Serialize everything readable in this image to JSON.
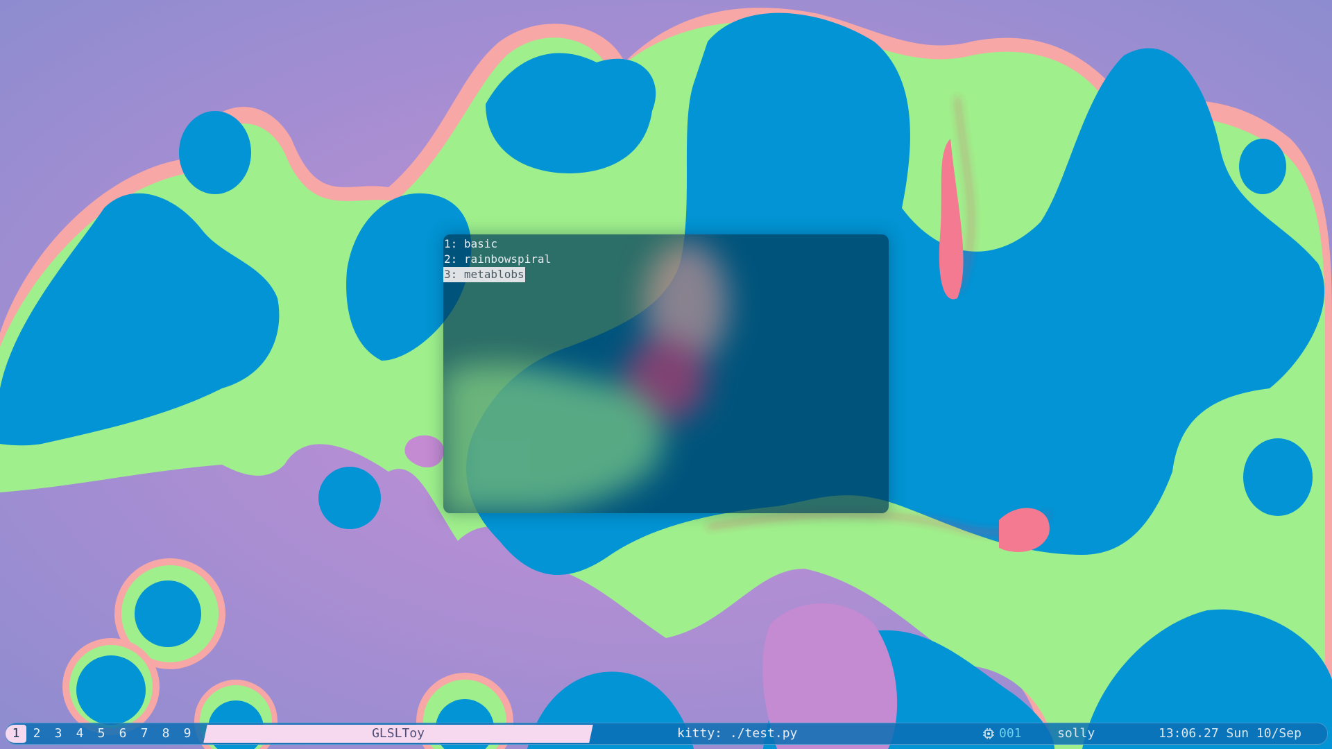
{
  "terminal_menu": {
    "items": [
      {
        "label": "1: basic",
        "selected": false
      },
      {
        "label": "2: rainbowspiral",
        "selected": false
      },
      {
        "label": "3: metablobs",
        "selected": true
      }
    ]
  },
  "statusbar": {
    "workspaces": [
      "1",
      "2",
      "3",
      "4",
      "5",
      "6",
      "7",
      "8",
      "9"
    ],
    "active_workspace": "1",
    "window_title": "GLSLToy",
    "focused_app": "kitty: ./test.py",
    "cpu_icon": "cpu-icon",
    "cpu_value": "001",
    "user": "solly",
    "clock": "13:06.27 Sun 10/Sep"
  },
  "colors": {
    "wallpaper_base": "#8f86cf",
    "blob_blue": "#0294d4",
    "blob_green": "#9ff08c",
    "blob_pink": "#f9a9a0",
    "blob_rim": "#e8336b",
    "bar_accent": "#f6d8ef"
  }
}
